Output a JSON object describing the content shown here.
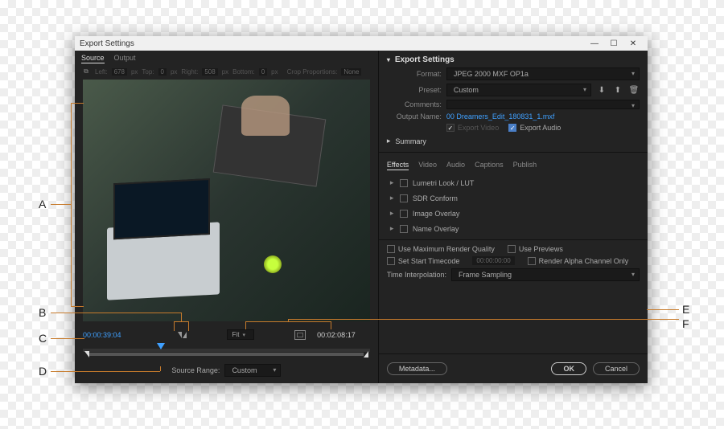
{
  "window": {
    "title": "Export Settings",
    "minimize": "—",
    "maximize": "☐",
    "close": "✕"
  },
  "left": {
    "tabs": {
      "source": "Source",
      "output": "Output"
    },
    "crop": {
      "left_label": "Left:",
      "left_val": "678",
      "top_label": "Top:",
      "top_val": "0",
      "right_label": "Right:",
      "right_val": "508",
      "bottom_label": "Bottom:",
      "bottom_val": "0",
      "px": "px",
      "proportions_label": "Crop Proportions:",
      "proportions_val": "None"
    },
    "tc_current": "00:00:39:04",
    "tc_duration": "00:02:08:17",
    "zoom": "Fit",
    "source_range_label": "Source Range:",
    "source_range_val": "Custom"
  },
  "right": {
    "header": "Export Settings",
    "format_label": "Format:",
    "format_val": "JPEG 2000 MXF OP1a",
    "preset_label": "Preset:",
    "preset_val": "Custom",
    "comments_label": "Comments:",
    "comments_val": "",
    "output_label": "Output Name:",
    "output_val": "00 Dreamers_Edit_180831_1.mxf",
    "export_video": "Export Video",
    "export_audio": "Export Audio",
    "summary": "Summary",
    "sub_tabs": {
      "effects": "Effects",
      "video": "Video",
      "audio": "Audio",
      "captions": "Captions",
      "publish": "Publish"
    },
    "fx": {
      "lumetri": "Lumetri Look / LUT",
      "sdr": "SDR Conform",
      "image_overlay": "Image Overlay",
      "name_overlay": "Name Overlay"
    },
    "render": {
      "max_quality": "Use Maximum Render Quality",
      "use_previews": "Use Previews",
      "set_start": "Set Start Timecode",
      "start_val": "00:00:00:00",
      "alpha_only": "Render Alpha Channel Only",
      "time_interp_label": "Time Interpolation:",
      "time_interp_val": "Frame Sampling"
    },
    "buttons": {
      "metadata": "Metadata...",
      "ok": "OK",
      "cancel": "Cancel"
    }
  },
  "annotations": {
    "A": "A",
    "B": "B",
    "C": "C",
    "D": "D",
    "E": "E",
    "F": "F"
  }
}
